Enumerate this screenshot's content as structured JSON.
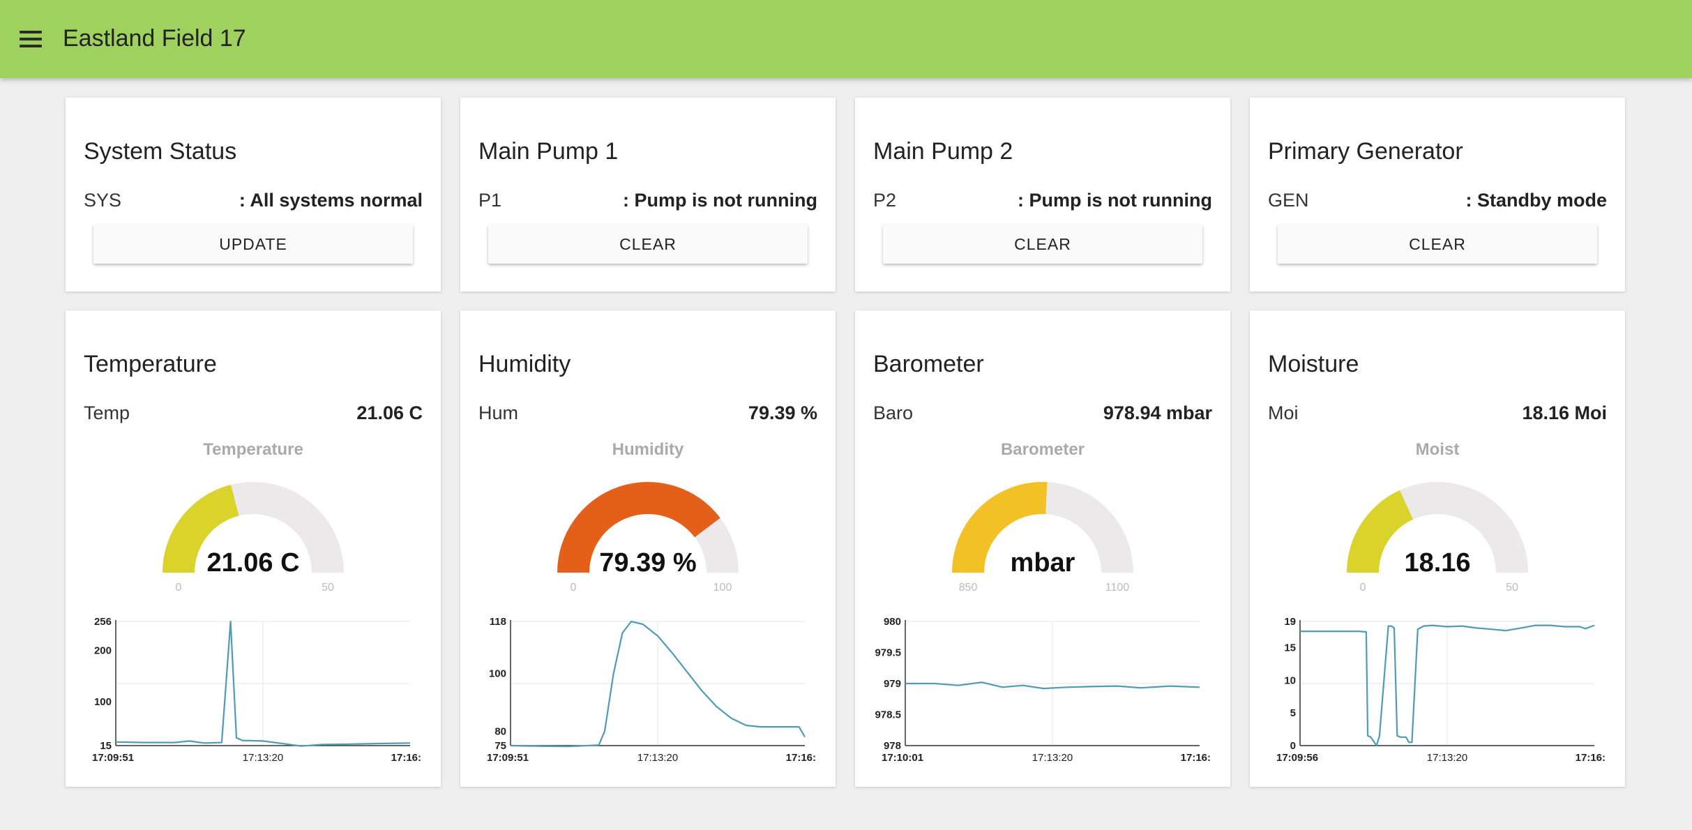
{
  "app": {
    "title": "Eastland Field 17"
  },
  "status_cards": [
    {
      "title": "System Status",
      "label": "SYS",
      "value": ": All systems normal",
      "button": "UPDATE"
    },
    {
      "title": "Main Pump 1",
      "label": "P1",
      "value": ": Pump is not running",
      "button": "CLEAR"
    },
    {
      "title": "Main Pump 2",
      "label": "P2",
      "value": ": Pump is not running",
      "button": "CLEAR"
    },
    {
      "title": "Primary Generator",
      "label": "GEN",
      "value": ": Standby mode",
      "button": "CLEAR"
    }
  ],
  "sensor_cards": [
    {
      "title": "Temperature",
      "label": "Temp",
      "value": "21.06 C",
      "gauge": {
        "title": "Temperature",
        "display": "21.06 C",
        "min": 0,
        "max": 50,
        "min_label": "0",
        "max_label": "50",
        "value": 21.06,
        "color": "#d9d32b"
      },
      "chart_data": {
        "type": "line",
        "y_ticks": [
          "256",
          "200",
          "100",
          "15"
        ],
        "ylim": [
          15,
          256
        ],
        "x_ticks": [
          "17:09:51",
          "17:13:20",
          "17:16:"
        ],
        "x": [
          0,
          0.1,
          0.2,
          0.25,
          0.3,
          0.36,
          0.39,
          0.41,
          0.43,
          0.5,
          0.58,
          0.63,
          0.7,
          0.8,
          0.9,
          1.0
        ],
        "y": [
          22,
          21,
          21,
          24,
          20,
          21,
          256,
          30,
          25,
          24,
          18,
          14,
          17,
          18,
          19,
          20
        ]
      }
    },
    {
      "title": "Humidity",
      "label": "Hum",
      "value": "79.39 %",
      "gauge": {
        "title": "Humidity",
        "display": "79.39 %",
        "min": 0,
        "max": 100,
        "min_label": "0",
        "max_label": "100",
        "value": 79.39,
        "color": "#e35f1a"
      },
      "chart_data": {
        "type": "line",
        "y_ticks": [
          "118",
          "100",
          "80",
          "75"
        ],
        "ylim": [
          75,
          118
        ],
        "x_ticks": [
          "17:09:51",
          "17:13:20",
          "17:16:"
        ],
        "x": [
          0,
          0.1,
          0.2,
          0.3,
          0.32,
          0.35,
          0.38,
          0.41,
          0.45,
          0.5,
          0.55,
          0.6,
          0.65,
          0.7,
          0.75,
          0.8,
          0.85,
          0.9,
          0.98,
          1.0
        ],
        "y": [
          75,
          74.8,
          74.7,
          75.2,
          80,
          100,
          114,
          118,
          117,
          113,
          107,
          100.5,
          94,
          88.5,
          84.5,
          82,
          81.5,
          81.5,
          81.5,
          78
        ]
      }
    },
    {
      "title": "Barometer",
      "label": "Baro",
      "value": "978.94 mbar",
      "gauge": {
        "title": "Barometer",
        "display": "mbar",
        "min": 850,
        "max": 1100,
        "min_label": "850",
        "max_label": "1100",
        "value": 978.94,
        "color": "#f1c126"
      },
      "chart_data": {
        "type": "line",
        "y_ticks": [
          "980",
          "979.5",
          "979",
          "978.5",
          "978"
        ],
        "ylim": [
          978,
          980
        ],
        "x_ticks": [
          "17:10:01",
          "17:13:20",
          "17:16:"
        ],
        "x": [
          0,
          0.1,
          0.18,
          0.26,
          0.33,
          0.4,
          0.47,
          0.55,
          0.63,
          0.72,
          0.8,
          0.9,
          1.0
        ],
        "y": [
          979.0,
          979.0,
          978.97,
          979.02,
          978.94,
          978.97,
          978.92,
          978.94,
          978.95,
          978.96,
          978.93,
          978.96,
          978.94
        ]
      }
    },
    {
      "title": "Moisture",
      "label": "Moi",
      "value": "18.16 Moi",
      "gauge": {
        "title": "Moist",
        "display": "18.16",
        "min": 0,
        "max": 50,
        "min_label": "0",
        "max_label": "50",
        "value": 18.16,
        "color": "#d9d32b"
      },
      "chart_data": {
        "type": "line",
        "y_ticks": [
          "19",
          "15",
          "10",
          "5",
          "0"
        ],
        "ylim": [
          0,
          19
        ],
        "x_ticks": [
          "17:09:56",
          "17:13:20",
          "17:16:"
        ],
        "x": [
          0,
          0.1,
          0.2,
          0.225,
          0.23,
          0.24,
          0.26,
          0.27,
          0.3,
          0.31,
          0.32,
          0.33,
          0.34,
          0.36,
          0.37,
          0.38,
          0.4,
          0.42,
          0.45,
          0.5,
          0.55,
          0.6,
          0.65,
          0.7,
          0.75,
          0.8,
          0.85,
          0.9,
          0.95,
          0.97,
          1.0
        ],
        "y": [
          17.5,
          17.5,
          17.5,
          17.4,
          1.5,
          1.3,
          0,
          1.5,
          18.3,
          18.3,
          18,
          1.5,
          1.3,
          1.3,
          0.5,
          0.5,
          17.8,
          18.3,
          18.4,
          18.2,
          18.3,
          18.0,
          17.8,
          17.6,
          18.0,
          18.4,
          18.4,
          18.2,
          18.2,
          17.9,
          18.4
        ]
      }
    }
  ]
}
